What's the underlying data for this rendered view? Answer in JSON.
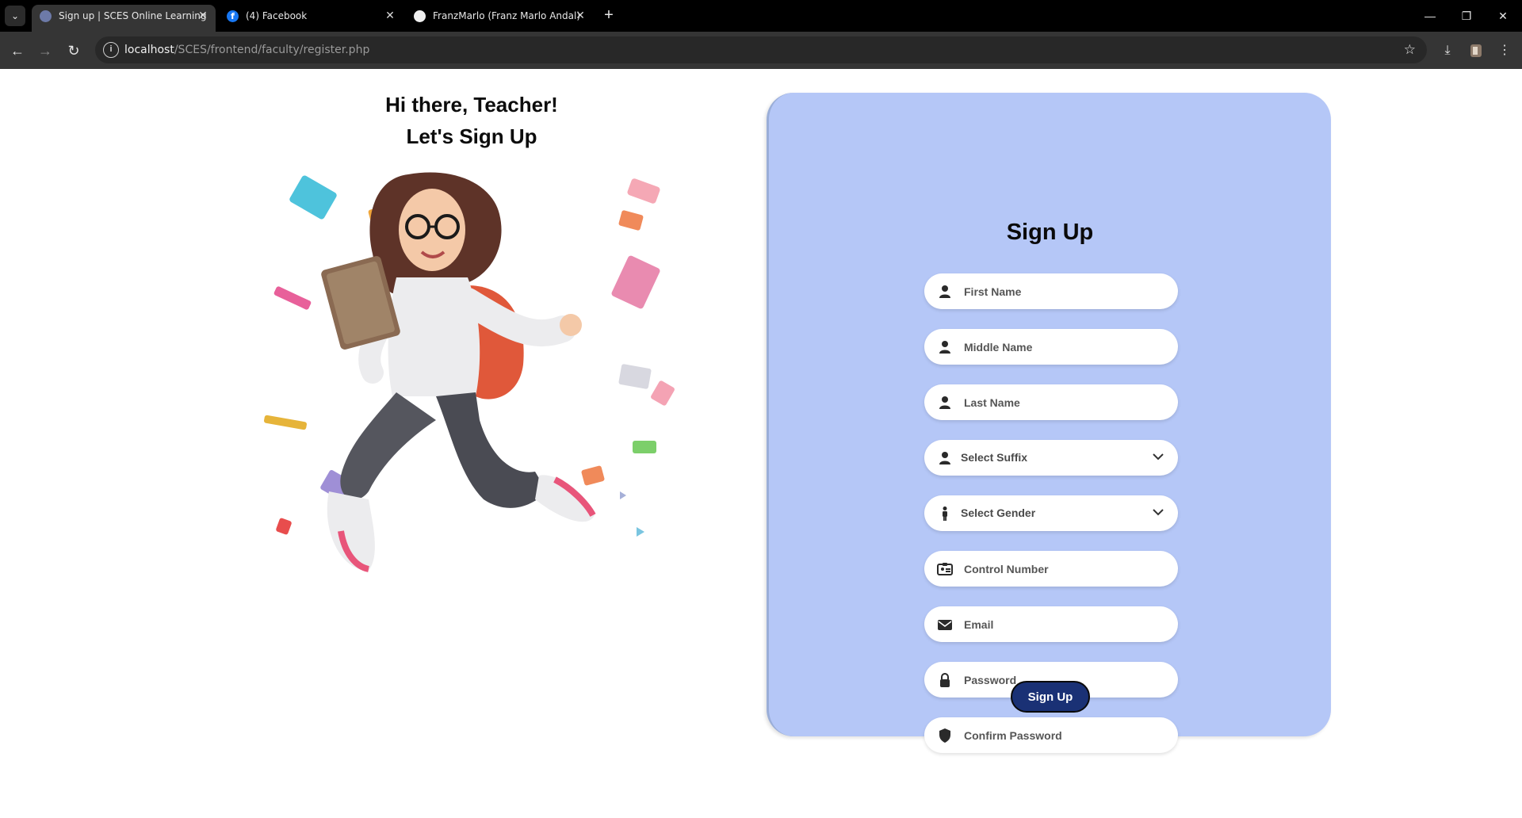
{
  "browser": {
    "tabs": [
      {
        "title": "Sign up | SCES Online Learning",
        "active": true
      },
      {
        "title": "(4) Facebook",
        "active": false
      },
      {
        "title": "FranzMarlo (Franz Marlo Andal)",
        "active": false
      }
    ],
    "url_host": "localhost",
    "url_path": "/SCES/frontend/faculty/register.php"
  },
  "hero": {
    "greeting": "Hi there, Teacher!",
    "subtitle": "Let's Sign Up"
  },
  "form": {
    "title": "Sign Up",
    "fields": [
      {
        "key": "first_name",
        "placeholder": "First Name",
        "icon": "user-icon"
      },
      {
        "key": "middle_name",
        "placeholder": "Middle Name",
        "icon": "user-icon"
      },
      {
        "key": "last_name",
        "placeholder": "Last Name",
        "icon": "user-icon"
      },
      {
        "key": "suffix",
        "placeholder": "Select Suffix",
        "icon": "user-icon"
      },
      {
        "key": "gender",
        "placeholder": "Select Gender",
        "icon": "person-standing-icon"
      },
      {
        "key": "control_number",
        "placeholder": "Control Number",
        "icon": "id-card-icon"
      },
      {
        "key": "email",
        "placeholder": "Email",
        "icon": "envelope-icon"
      },
      {
        "key": "password",
        "placeholder": "Password",
        "icon": "lock-icon"
      },
      {
        "key": "confirm_password",
        "placeholder": "Confirm Password",
        "icon": "shield-icon"
      }
    ],
    "submit_label": "Sign Up"
  },
  "colors": {
    "card_bg": "#b5c7f7",
    "button_bg": "#1a3175"
  }
}
